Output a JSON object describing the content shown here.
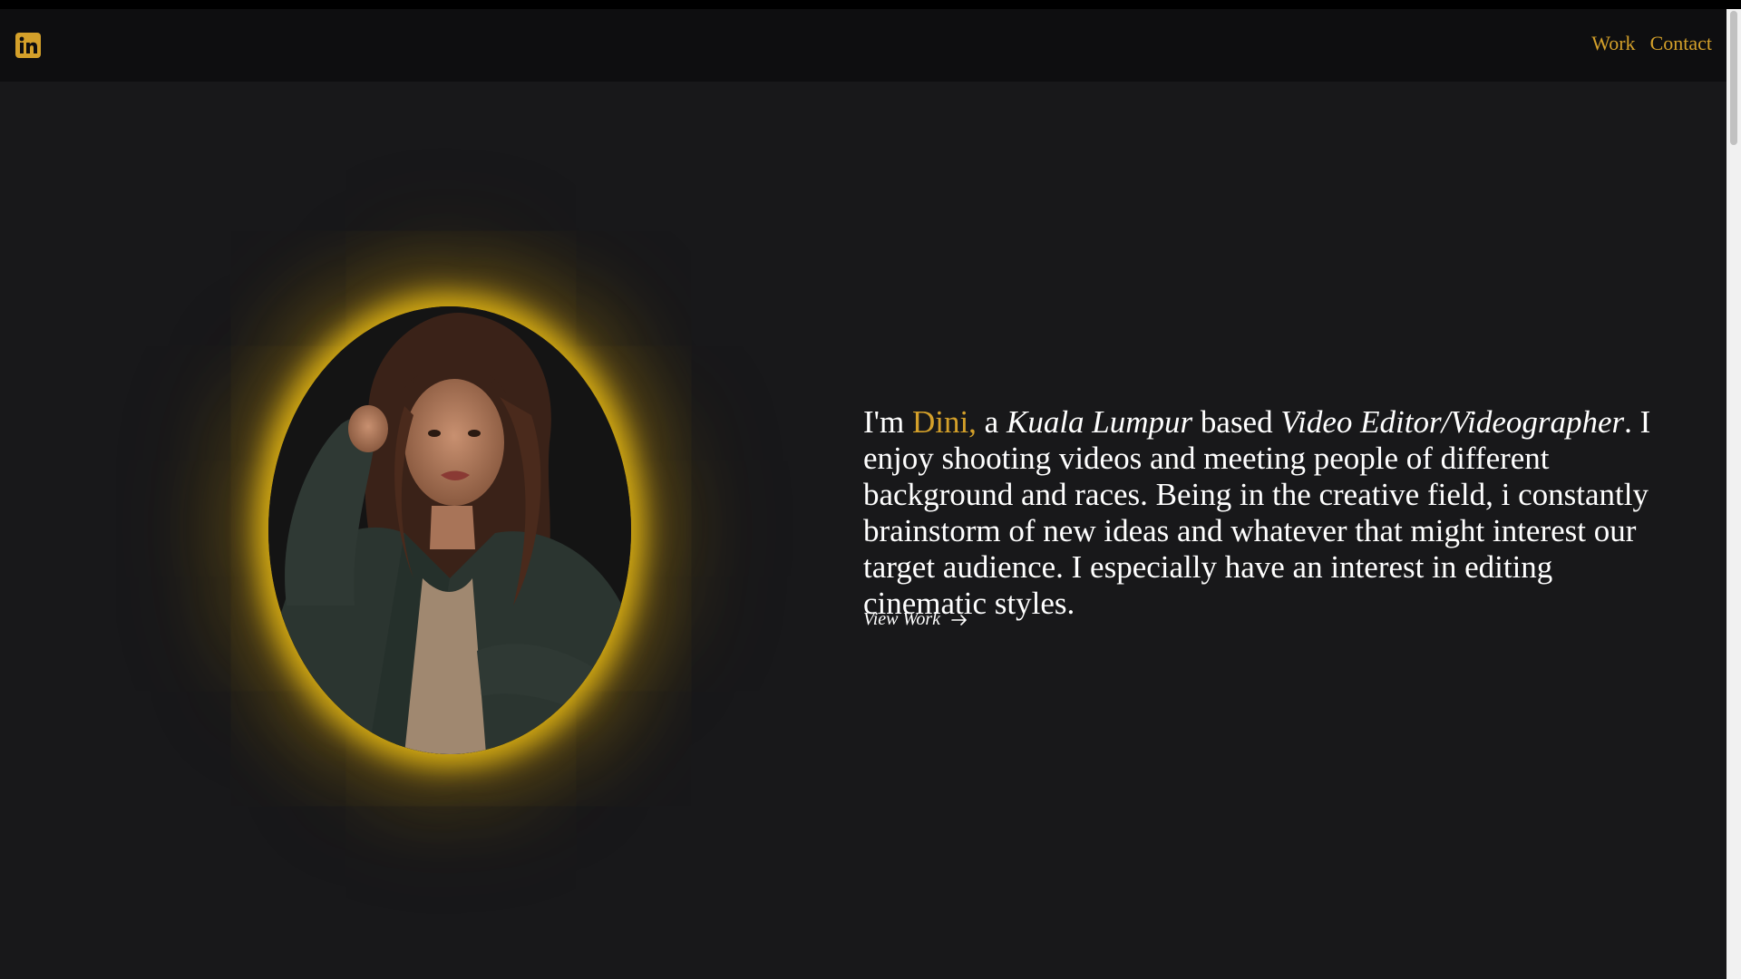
{
  "header": {
    "linkedin_icon": "linkedin-icon",
    "nav": [
      {
        "label": "Work"
      },
      {
        "label": "Contact"
      }
    ]
  },
  "hero": {
    "intro": {
      "prefix": "I'm ",
      "name": "Dini,",
      "a": " a ",
      "location": "Kuala Lumpur",
      "based": " based ",
      "role": "Video Editor/Videographer",
      "rest": ". I enjoy shooting videos and meeting people of different background and races. Being in the creative field, i constantly brainstorm of new ideas and whatever that might interest our target audience. I especially have an interest in editing cinematic styles."
    },
    "view_work": "View Work",
    "arrow_icon": "arrow-right-icon",
    "portrait_alt": "Portrait photo"
  },
  "colors": {
    "accent": "#d4a02a",
    "background": "#18181a",
    "navbar": "#0e0e10",
    "text": "#ffffff"
  }
}
